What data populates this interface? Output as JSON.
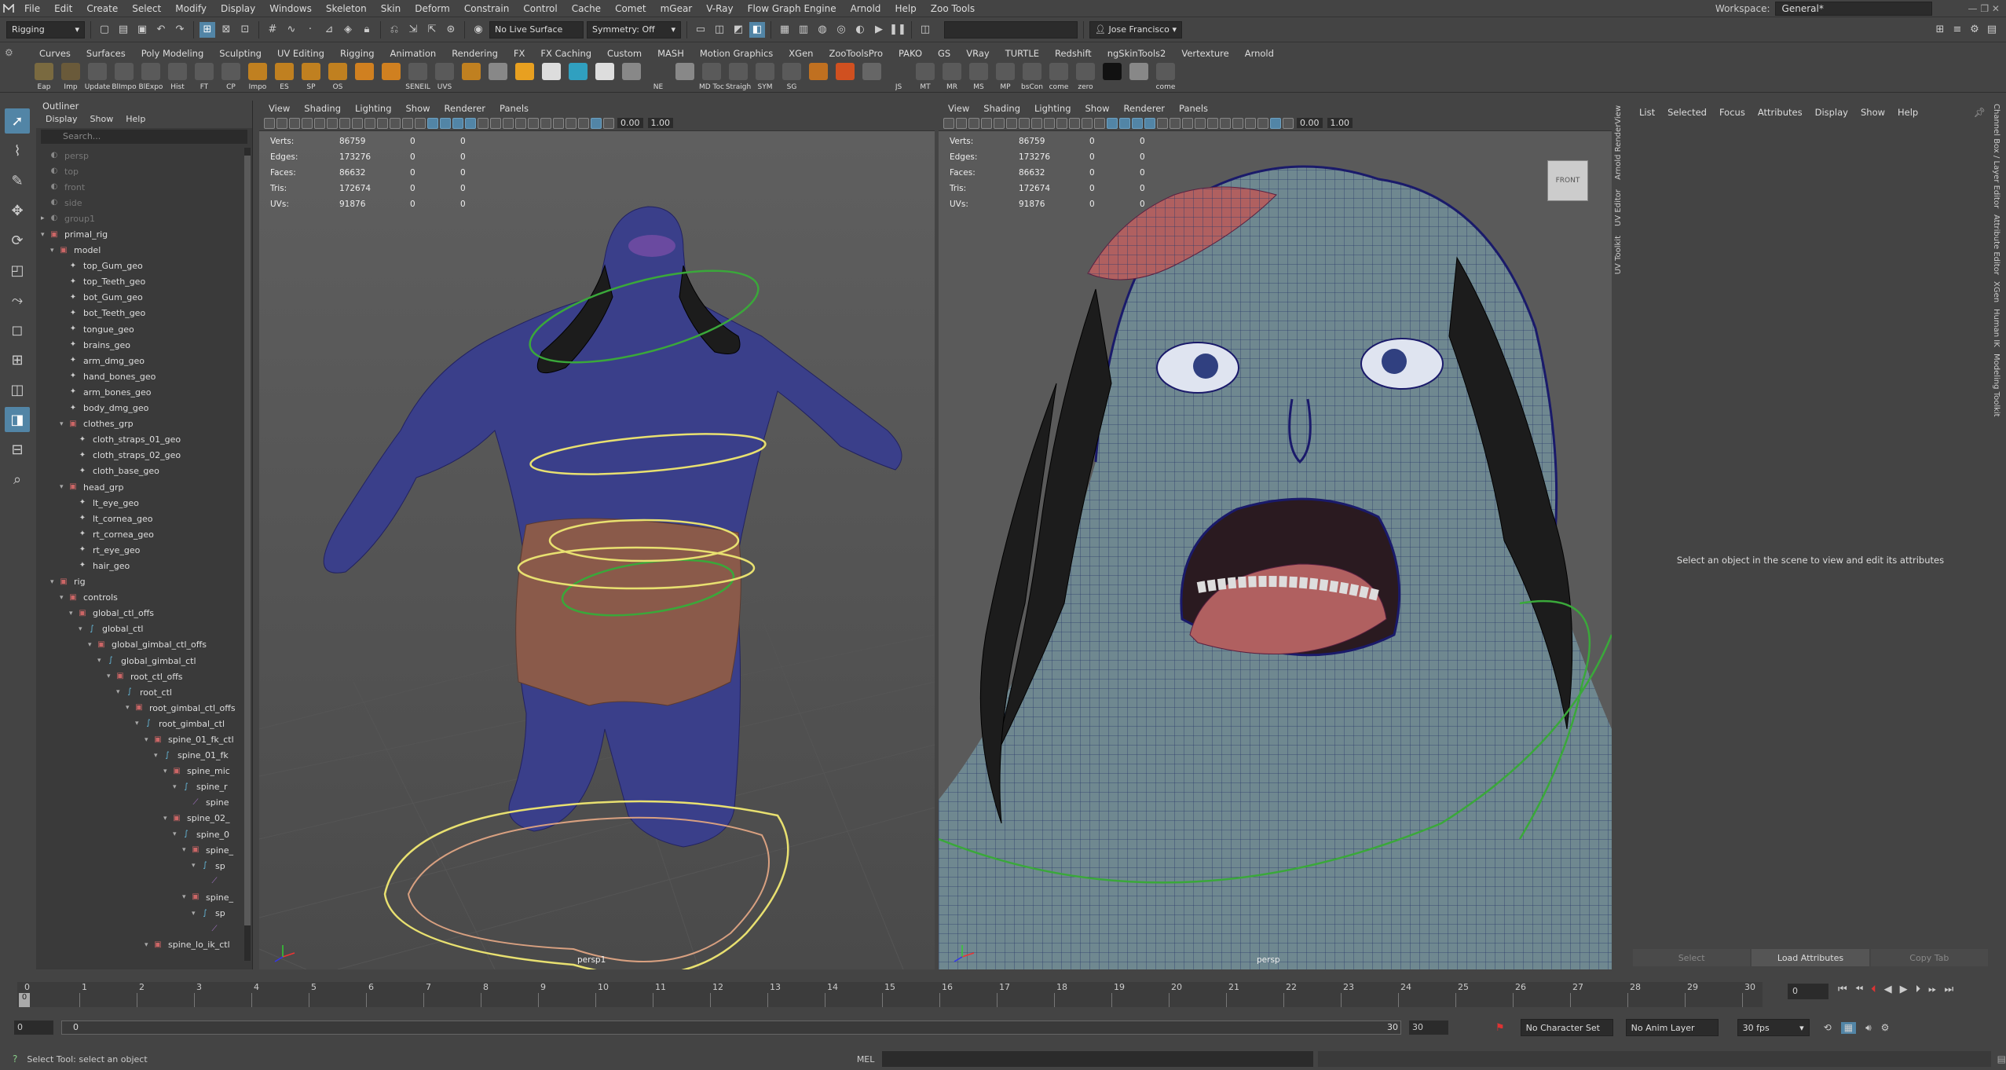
{
  "menubar": {
    "items": [
      "File",
      "Edit",
      "Create",
      "Select",
      "Modify",
      "Display",
      "Windows",
      "Skeleton",
      "Skin",
      "Deform",
      "Constrain",
      "Control",
      "Cache",
      "Comet",
      "mGear",
      "V-Ray",
      "Flow Graph Engine",
      "Arnold",
      "Help",
      "Zoo Tools"
    ],
    "workspace_label": "Workspace:",
    "workspace_value": "General*"
  },
  "statusline": {
    "mode": "Rigging",
    "live_surface": "No Live Surface",
    "symmetry": "Symmetry: Off",
    "user": "Jose Francisco"
  },
  "shelf_tabs": [
    "Curves",
    "Surfaces",
    "Poly Modeling",
    "Sculpting",
    "UV Editing",
    "Rigging",
    "Animation",
    "Rendering",
    "FX",
    "FX Caching",
    "Custom",
    "MASH",
    "Motion Graphics",
    "XGen",
    "ZooToolsPro",
    "PAKO",
    "GS",
    "VRay",
    "TURTLE",
    "Redshift",
    "ngSkinTools2",
    "Vertexture",
    "Arnold"
  ],
  "shelf_buttons": [
    {
      "label": "Eap",
      "color": "#7a6a40"
    },
    {
      "label": "Imp",
      "color": "#6a5a3a"
    },
    {
      "label": "Update",
      "color": "#5a5a5a"
    },
    {
      "label": "BlImpo",
      "color": "#5a5a5a"
    },
    {
      "label": "BlExpo",
      "color": "#5a5a5a"
    },
    {
      "label": "Hist",
      "color": "#5a5a5a"
    },
    {
      "label": "FT",
      "color": "#5a5a5a"
    },
    {
      "label": "CP",
      "color": "#5a5a5a"
    },
    {
      "label": "Impo",
      "color": "#c08020"
    },
    {
      "label": "ES",
      "color": "#c08020"
    },
    {
      "label": "SP",
      "color": "#c08020"
    },
    {
      "label": "OS",
      "color": "#c08020"
    },
    {
      "label": "",
      "color": "#d08020"
    },
    {
      "label": "",
      "color": "#d08020"
    },
    {
      "label": "SENEIL",
      "color": "#5a5a5a"
    },
    {
      "label": "UVS",
      "color": "#5a5a5a"
    },
    {
      "label": "",
      "color": "#c08020"
    },
    {
      "label": "",
      "color": "#888"
    },
    {
      "label": "",
      "color": "#e8a020"
    },
    {
      "label": "",
      "color": "#ddd"
    },
    {
      "label": "",
      "color": "#30a0c0"
    },
    {
      "label": "",
      "color": "#ddd"
    },
    {
      "label": "",
      "color": "#888"
    },
    {
      "label": "NE",
      "color": "#444"
    },
    {
      "label": "",
      "color": "#888"
    },
    {
      "label": "MD Toc",
      "color": "#5a5a5a"
    },
    {
      "label": "Straigh",
      "color": "#5a5a5a"
    },
    {
      "label": "SYM",
      "color": "#5a5a5a"
    },
    {
      "label": "SG",
      "color": "#5a5a5a"
    },
    {
      "label": "",
      "color": "#c07020"
    },
    {
      "label": "",
      "color": "#d05020"
    },
    {
      "label": "",
      "color": "#666"
    },
    {
      "label": "JS",
      "color": "#444"
    },
    {
      "label": "MT",
      "color": "#5a5a5a"
    },
    {
      "label": "MR",
      "color": "#5a5a5a"
    },
    {
      "label": "MS",
      "color": "#5a5a5a"
    },
    {
      "label": "MP",
      "color": "#5a5a5a"
    },
    {
      "label": "bsCon",
      "color": "#5a5a5a"
    },
    {
      "label": "come",
      "color": "#5a5a5a"
    },
    {
      "label": "zero",
      "color": "#5a5a5a"
    },
    {
      "label": "",
      "color": "#111"
    },
    {
      "label": "",
      "color": "#888"
    },
    {
      "label": "come",
      "color": "#5a5a5a"
    }
  ],
  "outliner": {
    "title": "Outliner",
    "menu": [
      "Display",
      "Show",
      "Help"
    ],
    "search_placeholder": "Search...",
    "items": [
      {
        "label": "persp",
        "indent": 0,
        "dim": true
      },
      {
        "label": "top",
        "indent": 0,
        "dim": true
      },
      {
        "label": "front",
        "indent": 0,
        "dim": true
      },
      {
        "label": "side",
        "indent": 0,
        "dim": true
      },
      {
        "label": "group1",
        "indent": 0,
        "dim": true,
        "exp": "+"
      },
      {
        "label": "primal_rig",
        "indent": 0,
        "exp": "-",
        "icon": "grp"
      },
      {
        "label": "model",
        "indent": 1,
        "exp": "-",
        "icon": "grp"
      },
      {
        "label": "top_Gum_geo",
        "indent": 2,
        "icon": "mesh"
      },
      {
        "label": "top_Teeth_geo",
        "indent": 2,
        "icon": "mesh"
      },
      {
        "label": "bot_Gum_geo",
        "indent": 2,
        "icon": "mesh"
      },
      {
        "label": "bot_Teeth_geo",
        "indent": 2,
        "icon": "mesh"
      },
      {
        "label": "tongue_geo",
        "indent": 2,
        "icon": "mesh"
      },
      {
        "label": "brains_geo",
        "indent": 2,
        "icon": "mesh"
      },
      {
        "label": "arm_dmg_geo",
        "indent": 2,
        "icon": "mesh"
      },
      {
        "label": "hand_bones_geo",
        "indent": 2,
        "icon": "mesh"
      },
      {
        "label": "arm_bones_geo",
        "indent": 2,
        "icon": "mesh"
      },
      {
        "label": "body_dmg_geo",
        "indent": 2,
        "icon": "mesh"
      },
      {
        "label": "clothes_grp",
        "indent": 2,
        "exp": "-",
        "icon": "grp"
      },
      {
        "label": "cloth_straps_01_geo",
        "indent": 3,
        "icon": "mesh"
      },
      {
        "label": "cloth_straps_02_geo",
        "indent": 3,
        "icon": "mesh"
      },
      {
        "label": "cloth_base_geo",
        "indent": 3,
        "icon": "mesh"
      },
      {
        "label": "head_grp",
        "indent": 2,
        "exp": "-",
        "icon": "grp"
      },
      {
        "label": "lt_eye_geo",
        "indent": 3,
        "icon": "mesh"
      },
      {
        "label": "lt_cornea_geo",
        "indent": 3,
        "icon": "mesh"
      },
      {
        "label": "rt_cornea_geo",
        "indent": 3,
        "icon": "mesh"
      },
      {
        "label": "rt_eye_geo",
        "indent": 3,
        "icon": "mesh"
      },
      {
        "label": "hair_geo",
        "indent": 3,
        "icon": "mesh"
      },
      {
        "label": "rig",
        "indent": 1,
        "exp": "-",
        "icon": "grp"
      },
      {
        "label": "controls",
        "indent": 2,
        "exp": "-",
        "icon": "grp"
      },
      {
        "label": "global_ctl_offs",
        "indent": 3,
        "exp": "-",
        "icon": "grp"
      },
      {
        "label": "global_ctl",
        "indent": 4,
        "exp": "-",
        "icon": "crv"
      },
      {
        "label": "global_gimbal_ctl_offs",
        "indent": 5,
        "exp": "-",
        "icon": "grp"
      },
      {
        "label": "global_gimbal_ctl",
        "indent": 6,
        "exp": "-",
        "icon": "crv"
      },
      {
        "label": "root_ctl_offs",
        "indent": 7,
        "exp": "-",
        "icon": "grp"
      },
      {
        "label": "root_ctl",
        "indent": 8,
        "exp": "-",
        "icon": "crv"
      },
      {
        "label": "root_gimbal_ctl_offs",
        "indent": 9,
        "exp": "-",
        "icon": "grp"
      },
      {
        "label": "root_gimbal_ctl",
        "indent": 10,
        "exp": "-",
        "icon": "crv"
      },
      {
        "label": "spine_01_fk_ctl",
        "indent": 11,
        "exp": "-",
        "icon": "grp"
      },
      {
        "label": "spine_01_fk",
        "indent": 12,
        "exp": "-",
        "icon": "crv"
      },
      {
        "label": "spine_mic",
        "indent": 13,
        "exp": "-",
        "icon": "grp"
      },
      {
        "label": "spine_r",
        "indent": 14,
        "exp": "-",
        "icon": "crv"
      },
      {
        "label": "spine",
        "indent": 15,
        "icon": "jnt"
      },
      {
        "label": "spine_02_",
        "indent": 13,
        "exp": "-",
        "icon": "grp"
      },
      {
        "label": "spine_0",
        "indent": 14,
        "exp": "-",
        "icon": "crv"
      },
      {
        "label": "spine_",
        "indent": 15,
        "exp": "-",
        "icon": "grp"
      },
      {
        "label": "sp",
        "indent": 16,
        "exp": "-",
        "icon": "crv"
      },
      {
        "label": "",
        "indent": 17,
        "icon": "jnt"
      },
      {
        "label": "spine_",
        "indent": 15,
        "exp": "-",
        "icon": "grp"
      },
      {
        "label": "sp",
        "indent": 16,
        "exp": "-",
        "icon": "crv"
      },
      {
        "label": "",
        "indent": 17,
        "icon": "jnt"
      },
      {
        "label": "spine_lo_ik_ctl",
        "indent": 11,
        "exp": "-",
        "icon": "grp"
      }
    ]
  },
  "viewport_menu": [
    "View",
    "Shading",
    "Lighting",
    "Show",
    "Renderer",
    "Panels"
  ],
  "viewport_values": {
    "near": "0.00",
    "far": "1.00"
  },
  "hud": {
    "rows": [
      {
        "name": "Verts:",
        "a": "86759",
        "b": "0",
        "c": "0"
      },
      {
        "name": "Edges:",
        "a": "173276",
        "b": "0",
        "c": "0"
      },
      {
        "name": "Faces:",
        "a": "86632",
        "b": "0",
        "c": "0"
      },
      {
        "name": "Tris:",
        "a": "172674",
        "b": "0",
        "c": "0"
      },
      {
        "name": "UVs:",
        "a": "91876",
        "b": "0",
        "c": "0"
      }
    ]
  },
  "viewports": [
    {
      "camera": "persp1"
    },
    {
      "camera": "persp",
      "viewcube": "FRONT"
    }
  ],
  "side_tabs": [
    "Arnold RenderView",
    "UV Editor",
    "UV Toolkit"
  ],
  "right_edge_tabs": [
    "Channel Box / Layer Editor",
    "Attribute Editor",
    "XGen",
    "Human IK",
    "Modeling Toolkit"
  ],
  "attribute_editor": {
    "menu": [
      "List",
      "Selected",
      "Focus",
      "Attributes",
      "Display",
      "Show",
      "Help"
    ],
    "message": "Select an object in the scene to view and edit its attributes",
    "buttons": [
      "Select",
      "Load Attributes",
      "Copy Tab"
    ]
  },
  "timeslider": {
    "frames": [
      "0",
      "1",
      "2",
      "3",
      "4",
      "5",
      "6",
      "7",
      "8",
      "9",
      "10",
      "11",
      "12",
      "13",
      "14",
      "15",
      "16",
      "17",
      "18",
      "19",
      "20",
      "21",
      "22",
      "23",
      "24",
      "25",
      "26",
      "27",
      "28",
      "29",
      "30"
    ],
    "current": "0",
    "current_field": "0"
  },
  "range": {
    "start": "0",
    "inner_start": "0",
    "inner_end": "30",
    "end": "30",
    "character_set": "No Character Set",
    "anim_layer": "No Anim Layer",
    "fps": "30 fps"
  },
  "cmdline": {
    "help": "Select Tool: select an object",
    "lang": "MEL"
  }
}
